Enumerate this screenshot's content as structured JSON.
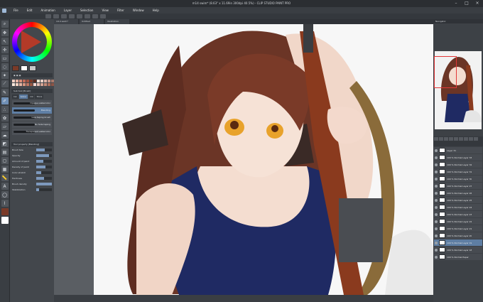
{
  "window": {
    "title": "m14 swim* (8.63\" x 11.69in 300dpi 40.5%) - CLIP STUDIO PAINT PRO"
  },
  "menu": [
    "File",
    "Edit",
    "Animation",
    "Layer",
    "Selection",
    "View",
    "Filter",
    "Window",
    "Help"
  ],
  "tabs": [
    "m14 swim*",
    "Untitled",
    "Illustration"
  ],
  "left_panel": {
    "subtool_header": "Sub tool [Brush]",
    "subtool_tabs": [
      "Ink",
      "Water",
      "Oil",
      "Thick",
      "Effect"
    ],
    "brushes": [
      {
        "label": "Opaque watercolor"
      },
      {
        "label": "Blending"
      },
      {
        "label": "Less taping brush"
      },
      {
        "label": "No fade taping"
      },
      {
        "label": "Transparent watercolor"
      }
    ],
    "tool_property_header": "Tool property [Blending]",
    "properties": [
      {
        "label": "Brush Size",
        "value": 0.55
      },
      {
        "label": "Opacity",
        "value": 0.8
      },
      {
        "label": "Amount of paint",
        "value": 0.45
      },
      {
        "label": "Density of paint",
        "value": 0.6
      },
      {
        "label": "Color stretch",
        "value": 0.3
      },
      {
        "label": "Hardness",
        "value": 0.5
      },
      {
        "label": "Brush density",
        "value": 1.0
      },
      {
        "label": "Stabilization",
        "value": 0.2
      }
    ]
  },
  "navigator": {
    "header": "Navigator"
  },
  "layers": [
    {
      "name": "Layer 31",
      "selected": false
    },
    {
      "name": "100 % Normal Layer 33",
      "selected": false
    },
    {
      "name": "100 % Normal Layer 32",
      "selected": false
    },
    {
      "name": "100 % Normal Layer 31",
      "selected": false
    },
    {
      "name": "100 % Normal Layer 30",
      "selected": false
    },
    {
      "name": "100 % Normal Layer 27",
      "selected": false
    },
    {
      "name": "100 % Normal Layer 26",
      "selected": false
    },
    {
      "name": "100 % Normal Layer 25",
      "selected": false
    },
    {
      "name": "100 % Normal Layer 24",
      "selected": false
    },
    {
      "name": "100 % Normal Layer 23",
      "selected": false
    },
    {
      "name": "100 % Normal Layer 22",
      "selected": false
    },
    {
      "name": "100 % Normal Layer 21",
      "selected": false
    },
    {
      "name": "100 % Normal Layer 20",
      "selected": false
    },
    {
      "name": "100 % Normal Layer 19",
      "selected": true
    },
    {
      "name": "100 % Normal Layer 18",
      "selected": false
    },
    {
      "name": "100 % Normal Paper",
      "selected": false
    }
  ],
  "colors": {
    "main": "#7a3a28",
    "sub": "#ffffff",
    "transparent": "#c8c8c8",
    "hair": "#6b3526",
    "swimsuit": "#1f2a63",
    "skin": "#f4ddd0",
    "rifle_wood": "#8a3a1e",
    "rifle_metal": "#3a3d41"
  }
}
